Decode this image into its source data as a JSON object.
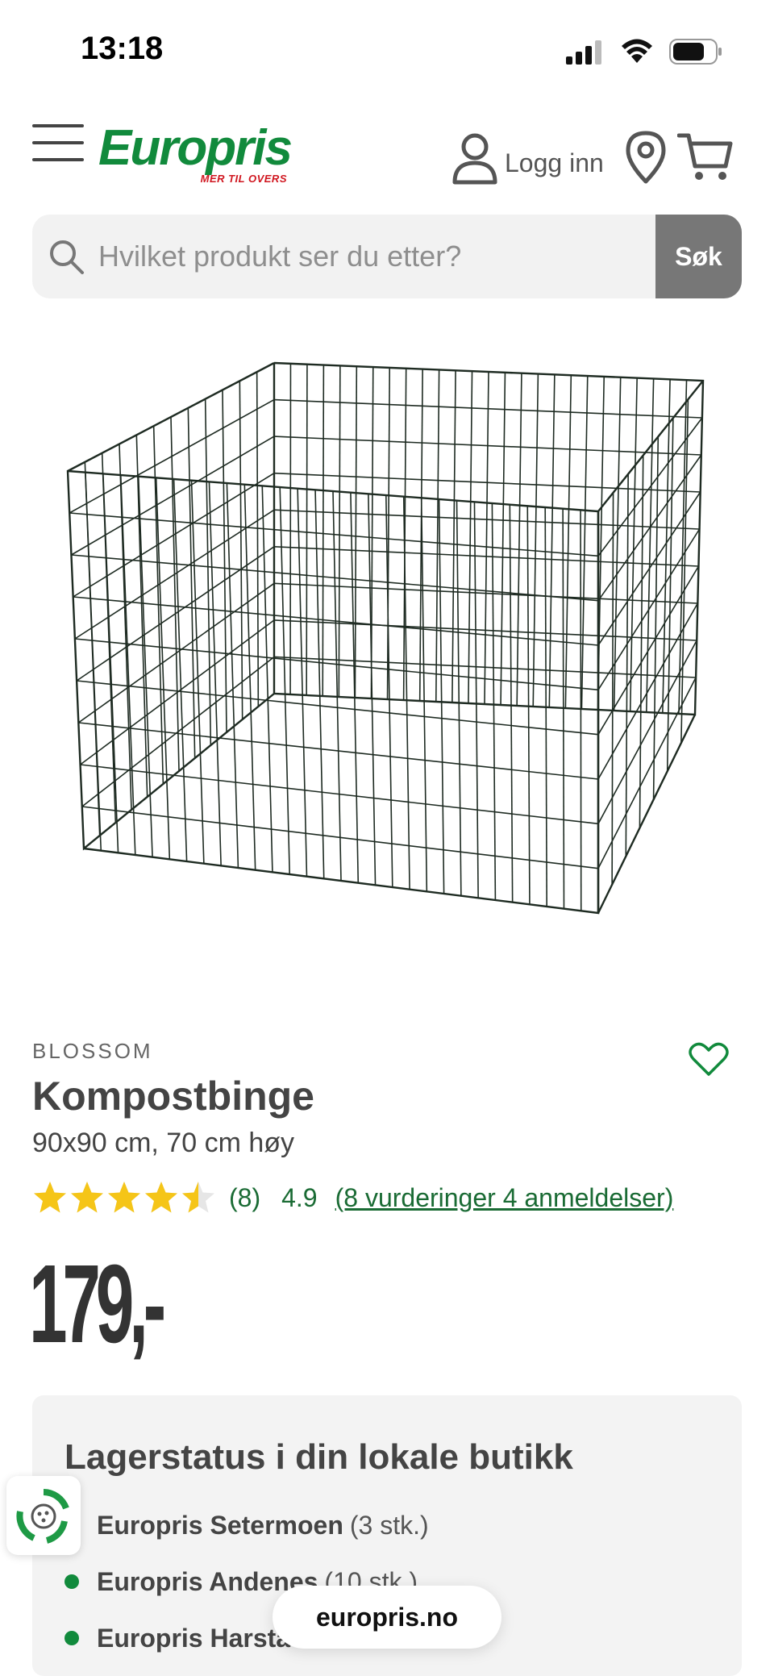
{
  "status_bar": {
    "time": "13:18"
  },
  "header": {
    "logo_text": "Europris",
    "logo_tagline": "MER TIL OVERS",
    "login_label": "Logg inn"
  },
  "search": {
    "placeholder": "Hvilket produkt ser du etter?",
    "button_label": "Søk"
  },
  "product": {
    "brand": "BLOSSOM",
    "title": "Kompostbinge",
    "subtitle": "90x90 cm, 70 cm høy",
    "rating_stars": 4.5,
    "rating_count_text": "(8)",
    "rating_score": "4.9",
    "reviews_link": "(8 vurderinger 4 anmeldelser)",
    "price": "179,-"
  },
  "stock": {
    "heading": "Lagerstatus i din lokale butikk",
    "items": [
      {
        "name": "Europris Setermoen",
        "qty": "(3 stk.)"
      },
      {
        "name": "Europris Andenes",
        "qty": "(10 stk.)"
      },
      {
        "name": "Europris Harstad",
        "qty": ""
      }
    ]
  },
  "url_pill": {
    "text": "europris.no"
  },
  "colors": {
    "brand_green": "#118a3c",
    "brand_red": "#d0161f",
    "link_green": "#1a6b34",
    "star_yellow": "#f5c518",
    "search_button": "#777777"
  },
  "icons": [
    "signal-icon",
    "wifi-icon",
    "battery-icon",
    "menu-icon",
    "user-icon",
    "location-pin-icon",
    "cart-icon",
    "search-icon",
    "heart-icon",
    "star-icon",
    "recycle-icon"
  ]
}
